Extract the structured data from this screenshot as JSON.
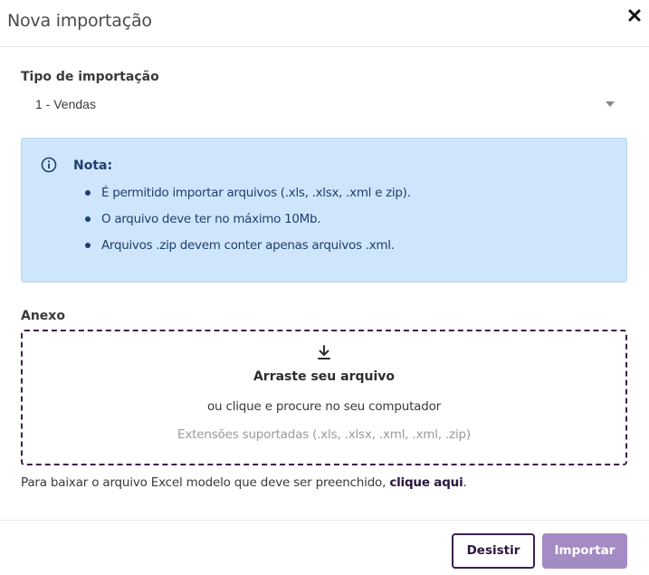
{
  "dialog": {
    "title": "Nova importação",
    "close_icon": "close-icon"
  },
  "import_type": {
    "label": "Tipo de importação",
    "selected": "1 - Vendas"
  },
  "note": {
    "icon": "info-icon",
    "title": "Nota:",
    "items": [
      "É permitido importar arquivos (.xls, .xlsx, .xml e zip).",
      "O arquivo deve ter no máximo 10Mb.",
      "Arquivos .zip devem conter apenas arquivos .xml."
    ],
    "background_color": "#cfe5fb",
    "text_color": "#1f3f6e"
  },
  "attachment": {
    "label": "Anexo",
    "icon": "download-arrow-icon",
    "title": "Arraste seu arquivo",
    "subtitle": "ou clique e procure no seu computador",
    "extensions": "Extensões suportadas (.xls, .xlsx, .xml, .xml, .zip)"
  },
  "template_download": {
    "text": "Para baixar o arquivo Excel modelo que deve ser preenchido,",
    "link": "clique aqui",
    "suffix": "."
  },
  "footer": {
    "cancel_label": "Desistir",
    "import_label": "Importar"
  },
  "colors": {
    "accent": "#3d1f4f",
    "primary_button": "#a48bc4"
  }
}
